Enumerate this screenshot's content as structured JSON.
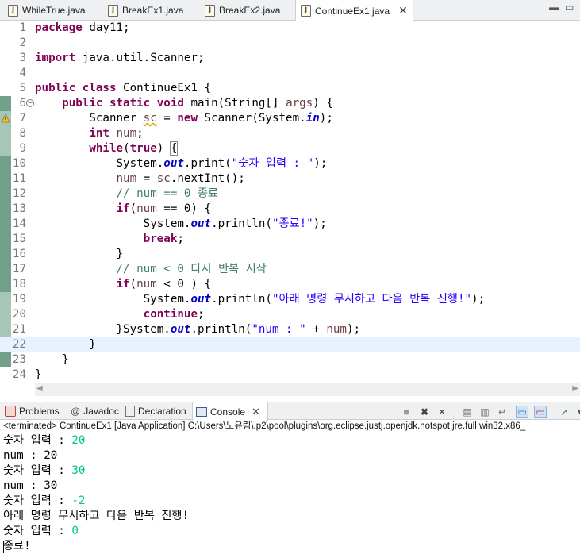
{
  "editor_tabs": [
    {
      "label": "WhileTrue.java",
      "active": false
    },
    {
      "label": "BreakEx1.java",
      "active": false
    },
    {
      "label": "BreakEx2.java",
      "active": false
    },
    {
      "label": "ContinueEx1.java",
      "active": true
    }
  ],
  "code_lines": [
    {
      "n": "1",
      "html": "<span class='kw'>package</span> day11;"
    },
    {
      "n": "2",
      "html": ""
    },
    {
      "n": "3",
      "html": "<span class='kw'>import</span> java.util.Scanner;"
    },
    {
      "n": "4",
      "html": ""
    },
    {
      "n": "5",
      "html": "<span class='kw'>public</span> <span class='kw'>class</span> ContinueEx1 {"
    },
    {
      "n": "6",
      "html": "    <span class='kw'>public</span> <span class='kw'>static</span> <span class='kw'>void</span> main(String[] <span class='var'>args</span>) {"
    },
    {
      "n": "7",
      "html": "        Scanner <span class='var warn-u'>sc</span> = <span class='kw'>new</span> Scanner(System.<span class='fld'>in</span>);"
    },
    {
      "n": "8",
      "html": "        <span class='kw'>int</span> <span class='var'>num</span>;"
    },
    {
      "n": "9",
      "html": "        <span class='kw'>while</span>(<span class='kw'>true</span>) <span class='bracket'>{</span>"
    },
    {
      "n": "10",
      "html": "            System.<span class='fld'>out</span>.print(<span class='str'>\"숫자 입력 : \"</span>);"
    },
    {
      "n": "11",
      "html": "            <span class='var'>num</span> = <span class='var'>sc</span>.nextInt();"
    },
    {
      "n": "12",
      "html": "            <span class='cmt'>// num == 0 종료</span>"
    },
    {
      "n": "13",
      "html": "            <span class='kw'>if</span>(<span class='var'>num</span> == 0) {"
    },
    {
      "n": "14",
      "html": "                System.<span class='fld'>out</span>.println(<span class='str'>\"종료!\"</span>);"
    },
    {
      "n": "15",
      "html": "                <span class='kw'>break</span>;"
    },
    {
      "n": "16",
      "html": "            }"
    },
    {
      "n": "17",
      "html": "            <span class='cmt'>// num &lt; 0 다시 반복 시작</span>"
    },
    {
      "n": "18",
      "html": "            <span class='kw'>if</span>(<span class='var'>num</span> &lt; 0 ) {"
    },
    {
      "n": "19",
      "html": "                System.<span class='fld'>out</span>.println(<span class='str'>\"아래 명령 무시하고 다음 반복 진행!\"</span>);"
    },
    {
      "n": "20",
      "html": "                <span class='kw'>continue</span>;"
    },
    {
      "n": "21",
      "html": "            }System.<span class='fld'>out</span>.println(<span class='str'>\"num : \"</span> + <span class='var'>num</span>);"
    },
    {
      "n": "22",
      "html": "        }"
    },
    {
      "n": "23",
      "html": "    }"
    },
    {
      "n": "24",
      "html": "}"
    }
  ],
  "view_tabs": {
    "problems": "Problems",
    "javadoc": "Javadoc",
    "declaration": "Declaration",
    "console": "Console"
  },
  "console": {
    "terminated": "<terminated> ContinueEx1 [Java Application] C:\\Users\\노유림\\.p2\\pool\\plugins\\org.eclipse.justj.openjdk.hotspot.jre.full.win32.x86_",
    "lines": [
      {
        "text": "숫자 입력 : ",
        "input": "20"
      },
      {
        "text": "num : 20",
        "input": ""
      },
      {
        "text": "숫자 입력 : ",
        "input": "30"
      },
      {
        "text": "num : 30",
        "input": ""
      },
      {
        "text": "숫자 입력 : ",
        "input": "-2"
      },
      {
        "text": "아래 명령 무시하고 다음 반복 진행!",
        "input": ""
      },
      {
        "text": "숫자 입력 : ",
        "input": "0"
      },
      {
        "text": "종료!",
        "input": ""
      }
    ]
  },
  "colors": {
    "keyword": "#7f0055",
    "string": "#2a00ff",
    "comment": "#3f7f5f",
    "field": "#0000c0",
    "console_input": "#00c87f",
    "current_line": "#e8f2fe"
  }
}
